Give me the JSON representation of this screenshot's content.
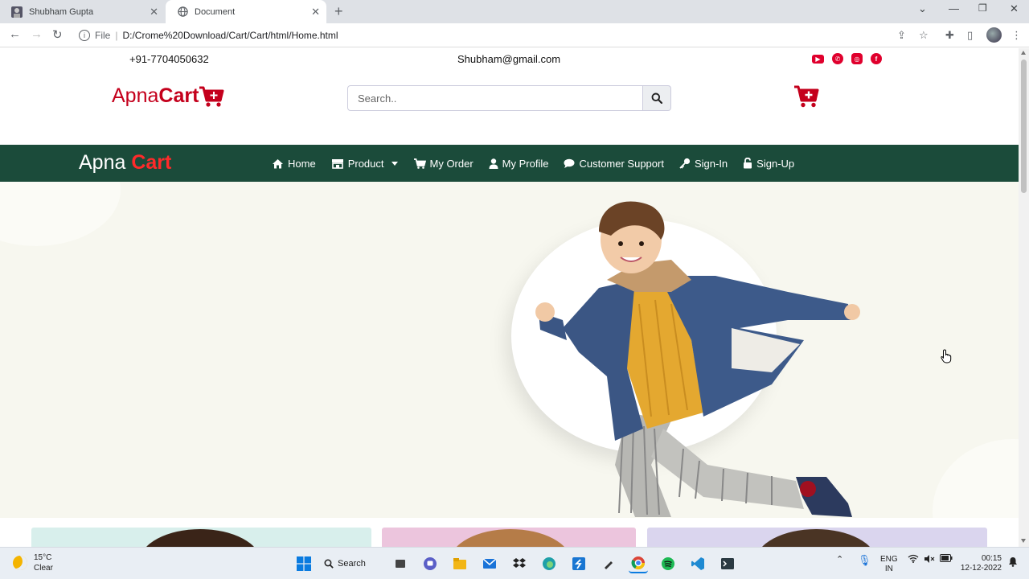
{
  "browser": {
    "tabs": [
      {
        "title": "Shubham Gupta",
        "active": false
      },
      {
        "title": "Document",
        "active": true
      }
    ],
    "file_label": "File",
    "url": "D:/Crome%20Download/Cart/Cart/html/Home.html"
  },
  "topbar": {
    "phone": "+91-7704050632",
    "email": "Shubham@gmail.com",
    "socials": [
      "youtube-icon",
      "whatsapp-icon",
      "instagram-icon",
      "facebook-icon"
    ]
  },
  "header": {
    "logo_light": "Apna",
    "logo_bold": "Cart",
    "search_placeholder": "Search.."
  },
  "navbar": {
    "brand_white": "Apna",
    "brand_red": "Cart",
    "links": {
      "home": "Home",
      "product": "Product",
      "my_order": "My Order",
      "my_profile": "My Profile",
      "customer_support": "Customer Support",
      "sign_in": "Sign-In",
      "sign_up": "Sign-Up"
    }
  },
  "taskbar": {
    "temperature": "15°C",
    "weather": "Clear",
    "search_label": "Search",
    "lang_line1": "ENG",
    "lang_line2": "IN",
    "time": "00:15",
    "date": "12-12-2022"
  },
  "colors": {
    "brand_red": "#c4001c",
    "navbar_green": "#1b4b3a",
    "hero_bg": "#f7f7ef"
  }
}
